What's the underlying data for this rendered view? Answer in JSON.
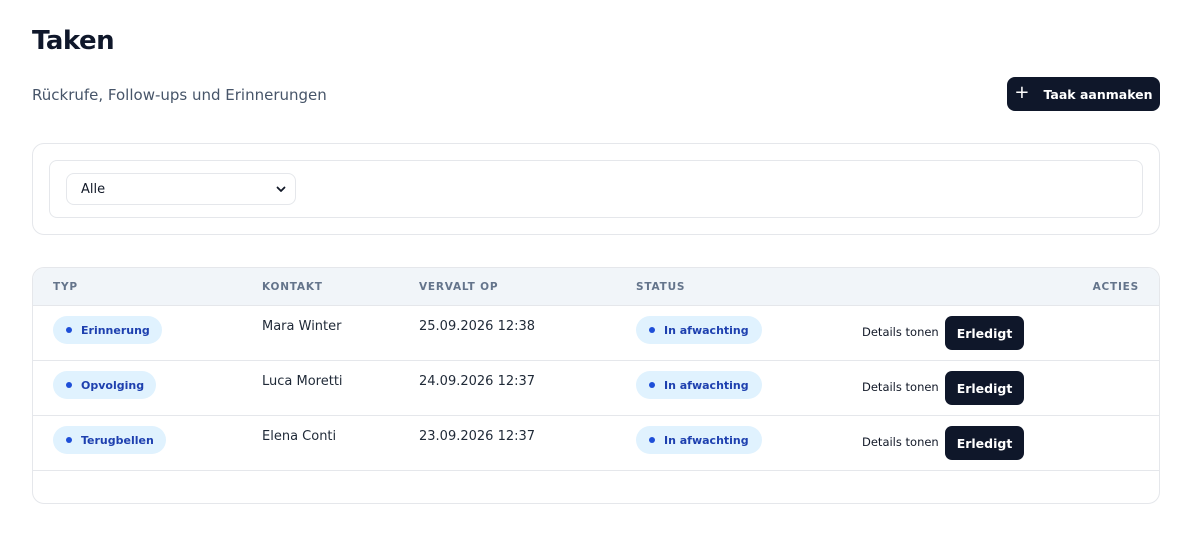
{
  "header": {
    "title": "Taken",
    "subtitle": "Rückrufe, Follow-ups und Erinnerungen",
    "create_label": "Taak aanmaken"
  },
  "filter": {
    "selected": "Alle"
  },
  "table": {
    "columns": [
      "TYP",
      "KONTAKT",
      "VERVALT OP",
      "STATUS",
      "ACTIES"
    ],
    "rows": [
      {
        "type": "Erinnerung",
        "contact": "Mara Winter",
        "due": "25.09.2026 12:38",
        "status": "In afwachting",
        "details": "Details tonen",
        "done": "Erledigt"
      },
      {
        "type": "Opvolging",
        "contact": "Luca Moretti",
        "due": "24.09.2026 12:37",
        "status": "In afwachting",
        "details": "Details tonen",
        "done": "Erledigt"
      },
      {
        "type": "Terugbellen",
        "contact": "Elena Conti",
        "due": "23.09.2026 12:37",
        "status": "In afwachting",
        "details": "Details tonen",
        "done": "Erledigt"
      }
    ]
  },
  "colors": {
    "primary_dark": "#0f172a",
    "badge_bg": "#e0f2fe",
    "badge_text": "#1e40af",
    "header_bg": "#f1f5f9"
  },
  "icons": {
    "create": "plus-icon",
    "select": "chevron-down-icon",
    "badge": "dot-icon"
  }
}
